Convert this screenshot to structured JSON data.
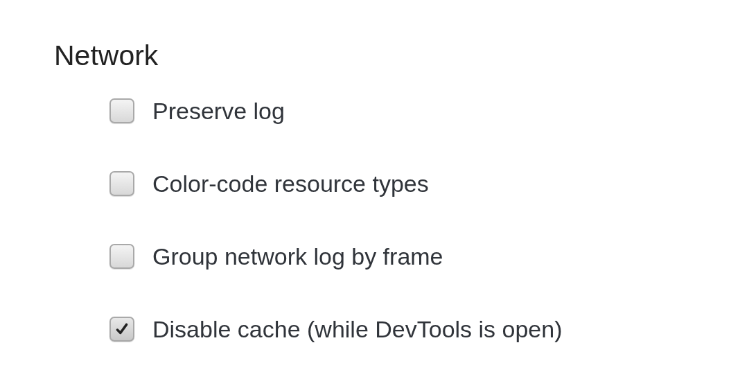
{
  "section": {
    "title": "Network"
  },
  "options": [
    {
      "label": "Preserve log",
      "checked": false
    },
    {
      "label": "Color-code resource types",
      "checked": false
    },
    {
      "label": "Group network log by frame",
      "checked": false
    },
    {
      "label": "Disable cache (while DevTools is open)",
      "checked": true
    }
  ]
}
